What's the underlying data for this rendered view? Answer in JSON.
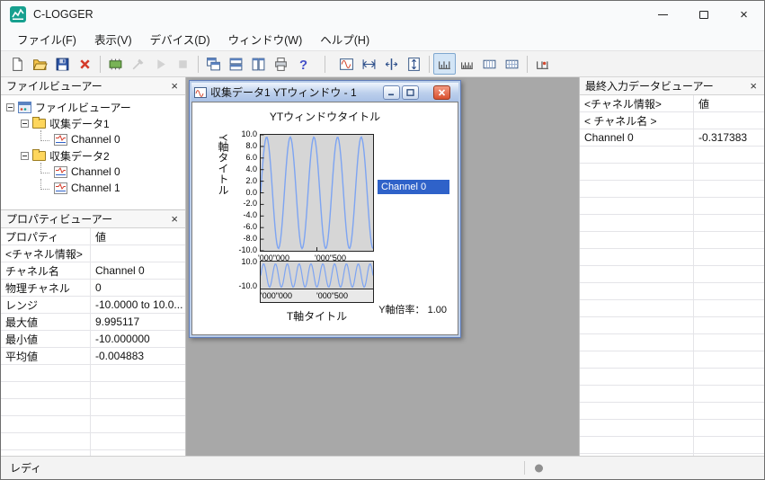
{
  "window": {
    "title": "C-LOGGER"
  },
  "menu": {
    "items": [
      "ファイル(F)",
      "表示(V)",
      "デバイス(D)",
      "ウィンドウ(W)",
      "ヘルプ(H)"
    ]
  },
  "toolbar": {
    "groups": [
      [
        {
          "name": "new-file",
          "state": "normal"
        },
        {
          "name": "open-file",
          "state": "normal"
        },
        {
          "name": "save-file",
          "state": "normal"
        },
        {
          "name": "delete",
          "state": "normal"
        }
      ],
      [
        {
          "name": "device-setup",
          "state": "normal"
        },
        {
          "name": "measure-setup",
          "state": "disabled"
        },
        {
          "name": "start-acquisition",
          "state": "disabled"
        },
        {
          "name": "stop-acquisition",
          "state": "disabled"
        }
      ],
      [
        {
          "name": "cascade-windows",
          "state": "normal"
        },
        {
          "name": "tile-horizontal",
          "state": "normal"
        },
        {
          "name": "tile-vertical",
          "state": "normal"
        },
        {
          "name": "print",
          "state": "normal"
        },
        {
          "name": "help",
          "state": "normal"
        }
      ],
      [
        {
          "name": "yt-window",
          "state": "normal"
        },
        {
          "name": "fit-time-axis",
          "state": "normal"
        },
        {
          "name": "cursor",
          "state": "normal"
        },
        {
          "name": "fit-y-axis",
          "state": "normal"
        }
      ],
      [
        {
          "name": "time-scale-1",
          "state": "pressed"
        },
        {
          "name": "time-scale-2",
          "state": "normal"
        },
        {
          "name": "time-scale-3",
          "state": "normal"
        },
        {
          "name": "time-scale-4",
          "state": "normal"
        }
      ],
      [
        {
          "name": "time-scale-5",
          "state": "normal"
        }
      ]
    ]
  },
  "file_viewer": {
    "title": "ファイルビューアー",
    "tree": {
      "root": "ファイルビューアー",
      "groups": [
        {
          "label": "収集データ1",
          "channels": [
            "Channel 0"
          ]
        },
        {
          "label": "収集データ2",
          "channels": [
            "Channel 0",
            "Channel 1"
          ]
        }
      ]
    }
  },
  "property_viewer": {
    "title": "プロパティビューアー",
    "columns": [
      "プロパティ",
      "値"
    ],
    "rows": [
      [
        "<チャネル情報>",
        ""
      ],
      [
        "チャネル名",
        "Channel 0"
      ],
      [
        "物理チャネル",
        "0"
      ],
      [
        "レンジ",
        "-10.0000 to 10.0..."
      ],
      [
        "最大値",
        "9.995117"
      ],
      [
        "最小値",
        "-10.000000"
      ],
      [
        "平均値",
        "-0.004883"
      ]
    ]
  },
  "last_input_viewer": {
    "title": "最終入力データビューアー",
    "columns": [
      "<チャネル情報>",
      "値"
    ],
    "rows": [
      [
        "< チャネル名 >",
        ""
      ],
      [
        "Channel 0",
        "-0.317383"
      ]
    ]
  },
  "child_window": {
    "title": "収集データ1 YTウィンドウ - 1",
    "y_scale_label": "Y軸倍率： 1.00"
  },
  "chart_data": [
    {
      "type": "line",
      "title": "YTウィンドウタイトル",
      "ylabel": "Y軸タイトル",
      "xlabel": "T軸タイトル",
      "ylim": [
        -10,
        10
      ],
      "y_ticks": [
        "10.0",
        "8.0",
        "6.0",
        "4.0",
        "2.0",
        "0.0",
        "-2.0",
        "-4.0",
        "-6.0",
        "-8.0",
        "-10.0"
      ],
      "x_ticks": [
        "'000\"000",
        "'000\"500"
      ],
      "grid": false,
      "legend_position": "right",
      "series": [
        {
          "name": "Channel 0",
          "waveform": "sine",
          "amplitude": 10,
          "cycles": 4.75,
          "color": "#7da4f2"
        }
      ]
    },
    {
      "type": "line",
      "role": "overview",
      "ylim": [
        -10,
        10
      ],
      "y_ticks": [
        "10.0",
        "-10.0"
      ],
      "x_ticks": [
        "'000\"000",
        "'000\"500"
      ],
      "series": [
        {
          "name": "Channel 0",
          "waveform": "sine",
          "amplitude": 10,
          "cycles": 9.5,
          "color": "#7da4f2"
        }
      ]
    }
  ],
  "status_bar": {
    "text": "レディ"
  }
}
